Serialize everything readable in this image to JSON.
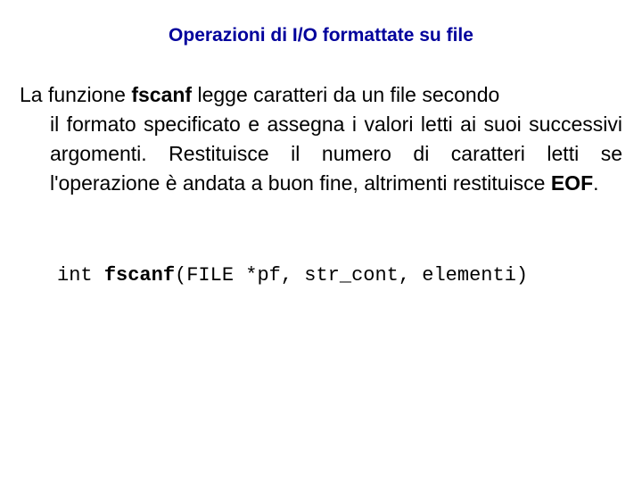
{
  "title": "Operazioni di I/O formattate su file",
  "paragraph": {
    "lead": "La funzione ",
    "func": "fscanf",
    "mid": " legge caratteri da un file secondo il formato specificato e assegna i valori letti ai suoi successivi argomenti. Restituisce il numero di caratteri letti se l'operazione è andata a buon fine, altrimenti restituisce ",
    "eof": "EOF",
    "end": "."
  },
  "code": {
    "ret": "int ",
    "name": "fscanf",
    "args": "(FILE *pf, str_cont, elementi)"
  }
}
